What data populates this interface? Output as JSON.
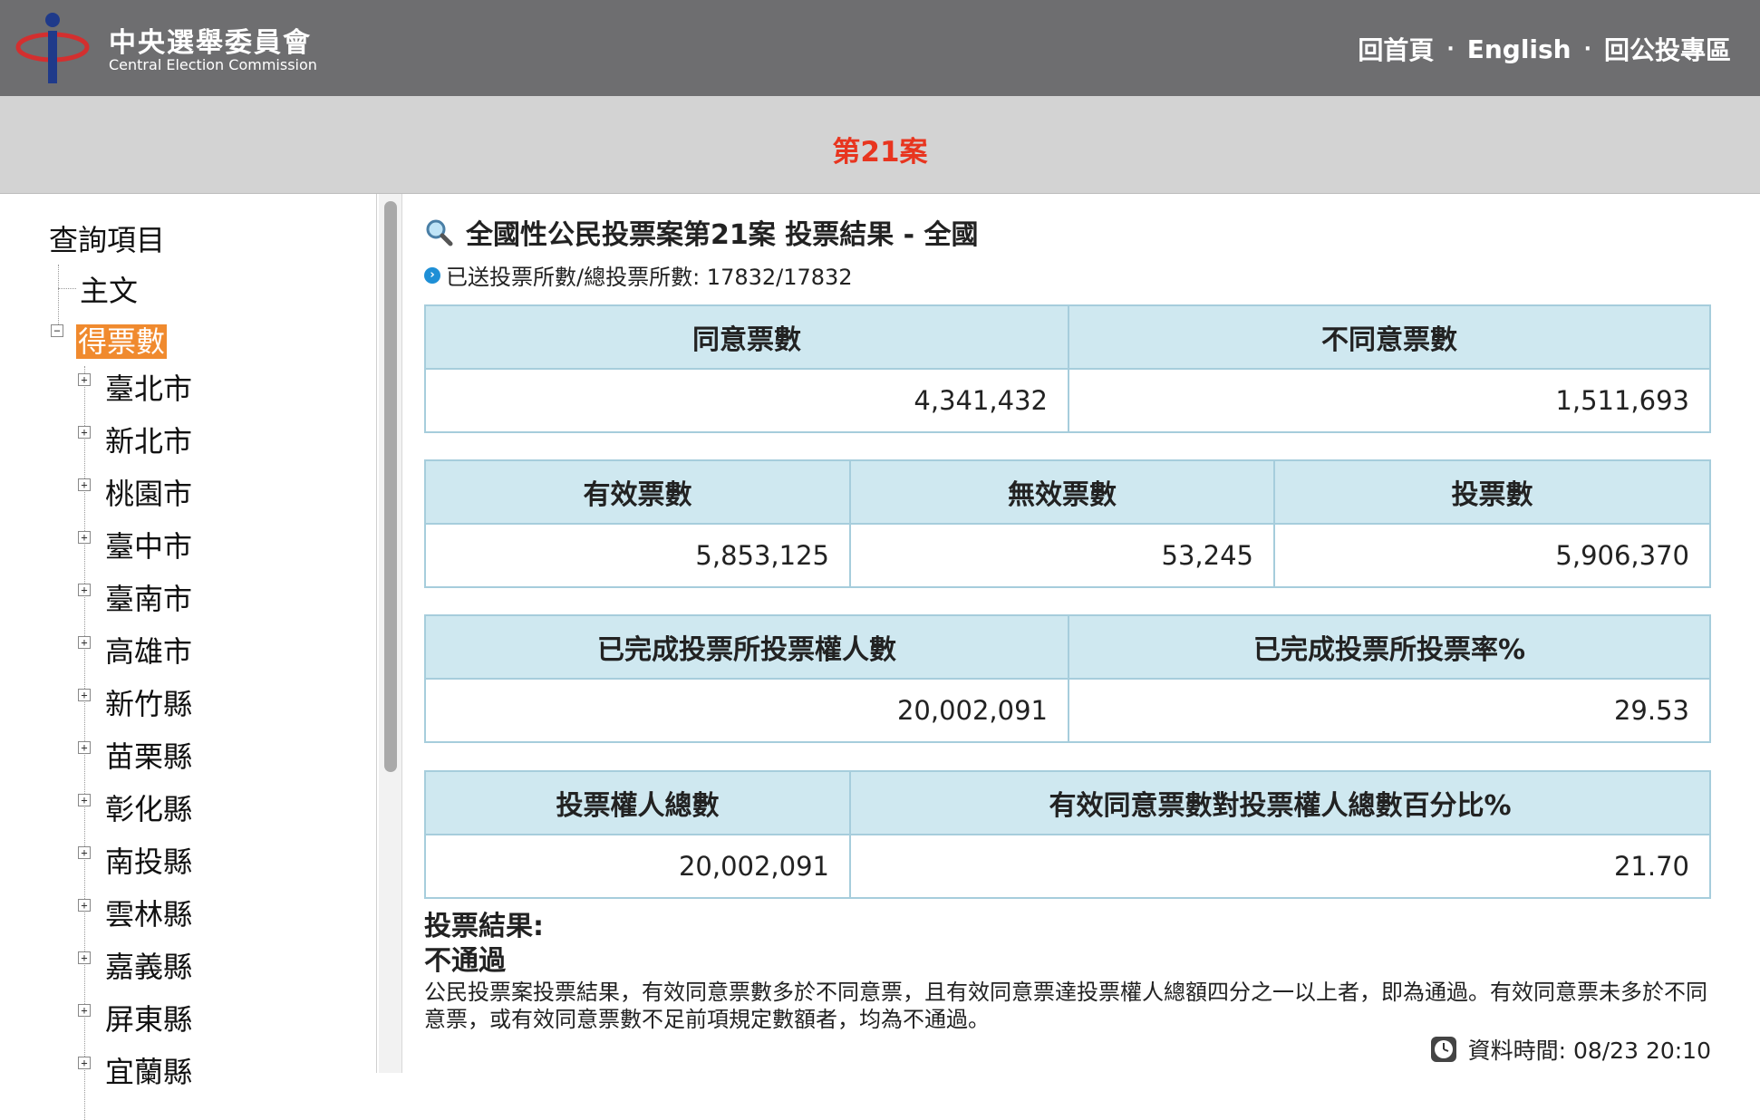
{
  "header": {
    "org_name_zh": "中央選舉委員會",
    "org_name_en": "Central Election Commission",
    "nav": [
      "回首頁",
      "English",
      "回公投專區"
    ],
    "nav_separator": "·"
  },
  "case_title": "第21案",
  "sidebar": {
    "root_label": "查詢項目",
    "nodes": [
      {
        "label": "主文",
        "expanded": null
      },
      {
        "label": "得票數",
        "expanded": true,
        "selected": true
      }
    ],
    "children": [
      "臺北市",
      "新北市",
      "桃園市",
      "臺中市",
      "臺南市",
      "高雄市",
      "新竹縣",
      "苗栗縣",
      "彰化縣",
      "南投縣",
      "雲林縣",
      "嘉義縣",
      "屏東縣",
      "宜蘭縣"
    ]
  },
  "main": {
    "title": "全國性公民投票案第21案 投票結果 - 全國",
    "stations": "已送投票所數/總投票所數: 17832/17832",
    "table1": {
      "headers": [
        "同意票數",
        "不同意票數"
      ],
      "values": [
        "4,341,432",
        "1,511,693"
      ]
    },
    "table2": {
      "headers": [
        "有效票數",
        "無效票數",
        "投票數"
      ],
      "values": [
        "5,853,125",
        "53,245",
        "5,906,370"
      ]
    },
    "table3": {
      "headers": [
        "已完成投票所投票權人數",
        "已完成投票所投票率%"
      ],
      "values": [
        "20,002,091",
        "29.53"
      ]
    },
    "table4": {
      "headers": [
        "投票權人總數",
        "有效同意票數對投票權人總數百分比%"
      ],
      "values": [
        "20,002,091",
        "21.70"
      ]
    },
    "result_heading": "投票結果:",
    "result_value": "不通過",
    "result_desc": "公民投票案投票結果，有效同意票數多於不同意票，且有效同意票達投票權人總額四分之一以上者，即為通過。有效同意票未多於不同意票，或有效同意票數不足前項規定數額者，均為不通過。",
    "data_time": "資料時間: 08/23 20:10"
  },
  "colors": {
    "header_bg": "#6e6e70",
    "case_title": "#e8351f",
    "selected_bg": "#f08a2e",
    "table_header_bg": "#cfe8f0",
    "table_border": "#a6cddc"
  }
}
